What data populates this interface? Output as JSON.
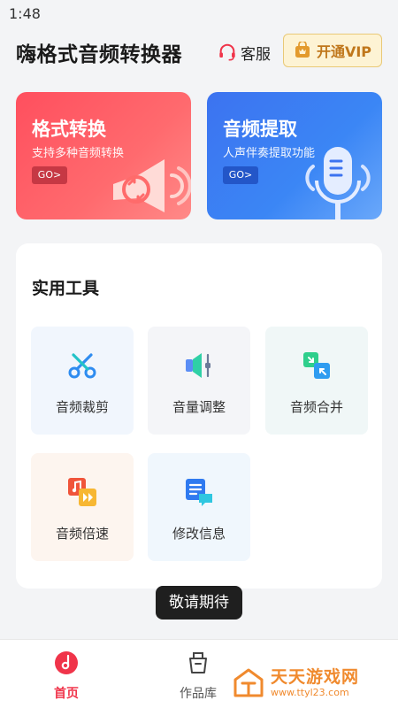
{
  "status_bar": {
    "time": "1:48"
  },
  "header": {
    "title": "嗨格式音频转换器",
    "service_label": "客服",
    "vip_label": "开通VIP",
    "service_icon": "headset-icon",
    "vip_icon": "crown-bag-icon"
  },
  "cards": [
    {
      "title": "格式转换",
      "subtitle": "支持多种音频转换",
      "go": "GO>",
      "icon": "convert-speaker-icon",
      "color": "#ff4f5e"
    },
    {
      "title": "音频提取",
      "subtitle": "人声伴奏提取功能",
      "go": "GO>",
      "icon": "microphone-icon",
      "color": "#3c73f0"
    }
  ],
  "tools": {
    "title": "实用工具",
    "items": [
      {
        "label": "音频裁剪",
        "icon": "scissors-icon"
      },
      {
        "label": "音量调整",
        "icon": "volume-adjust-icon"
      },
      {
        "label": "音频合并",
        "icon": "merge-icon"
      },
      {
        "label": "音频倍速",
        "icon": "speed-icon"
      },
      {
        "label": "修改信息",
        "icon": "edit-info-icon"
      }
    ]
  },
  "toast": "敬请期待",
  "tabbar": {
    "items": [
      {
        "label": "首页",
        "icon": "home-music-icon",
        "active": true
      },
      {
        "label": "作品库",
        "icon": "works-bag-icon",
        "active": false
      }
    ]
  },
  "watermark": {
    "title": "天天游戏网",
    "url": "www.ttyl23.com"
  },
  "colors": {
    "accent_red": "#f0344a",
    "vip_text": "#c0771b",
    "watermark": "#f08a2e"
  }
}
